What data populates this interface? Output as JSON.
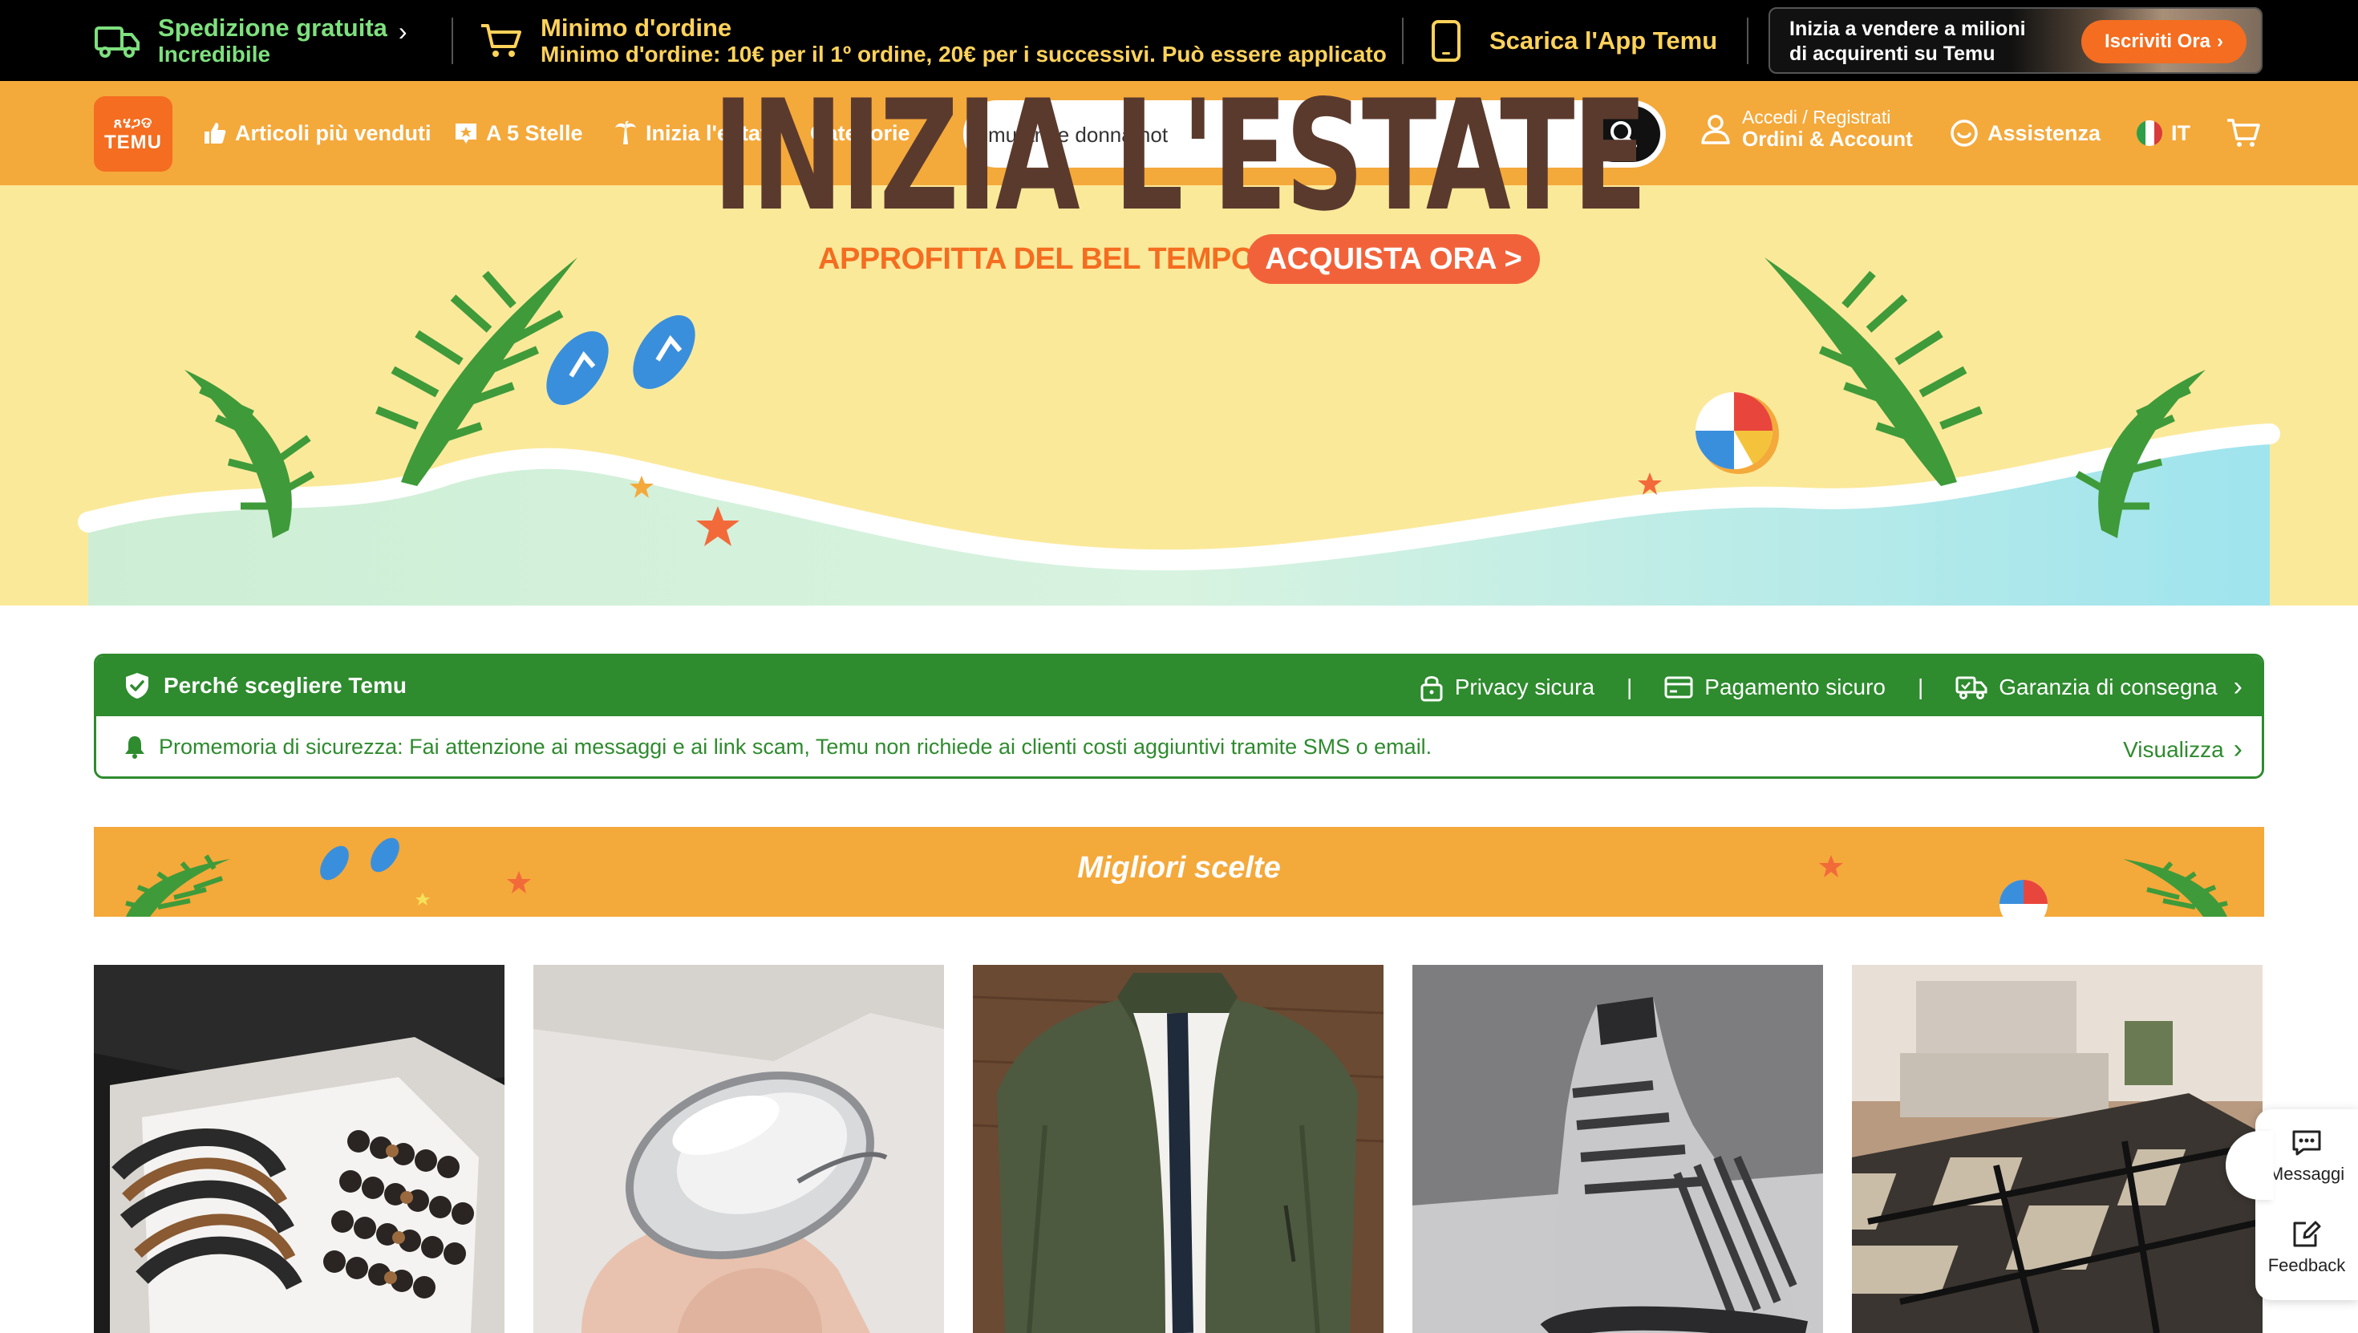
{
  "topbar": {
    "shipping_title": "Spedizione gratuita",
    "shipping_sub": "Incredibile",
    "minimum_title": "Minimo d'ordine",
    "minimum_sub": "Minimo d'ordine: 10€ per il 1º ordine, 20€ per i successivi. Può essere applicato",
    "app_label": "Scarica l'App Temu",
    "seller_text_1": "Inizia a vendere a milioni",
    "seller_text_2": "di acquirenti su Temu",
    "seller_button": "Iscriviti Ora"
  },
  "nav": {
    "logo_top": "ጸሄጋଡ",
    "logo_bottom": "TEMU",
    "links": [
      "Articoli più venduti",
      "A 5 Stelle",
      "Inizia l'estate",
      "Categorie"
    ],
    "search_value": "mutande donna hot",
    "account_small": "Accedi / Registrati",
    "account_big": "Ordini & Account",
    "support": "Assistenza",
    "language": "IT"
  },
  "hero": {
    "title": "INIZIA L'ESTATE",
    "subtitle": "APPROFITTA DEL BEL TEMPO",
    "cta": "ACQUISTA ORA >"
  },
  "trust": {
    "why": "Perché scegliere Temu",
    "privacy": "Privacy sicura",
    "payment": "Pagamento sicuro",
    "delivery": "Garanzia di consegna",
    "reminder": "Promemoria di sicurezza: Fai attenzione ai messaggi e ai link scam, Temu non richiede ai clienti costi aggiuntivi tramite SMS o email.",
    "view": "Visualizza"
  },
  "section": {
    "title": "Migliori scelte"
  },
  "products": [
    {
      "kind": "bracelets"
    },
    {
      "kind": "ring"
    },
    {
      "kind": "jacket"
    },
    {
      "kind": "sneaker"
    },
    {
      "kind": "rug"
    }
  ],
  "side": {
    "messages": "Messaggi",
    "feedback": "Feedback"
  },
  "colors": {
    "nav_orange": "#f4a93b",
    "brand_orange": "#f46d20",
    "trust_green": "#2e8b2e",
    "hero_yellow": "#fbe99a",
    "title_brown": "#5b3a2e"
  }
}
